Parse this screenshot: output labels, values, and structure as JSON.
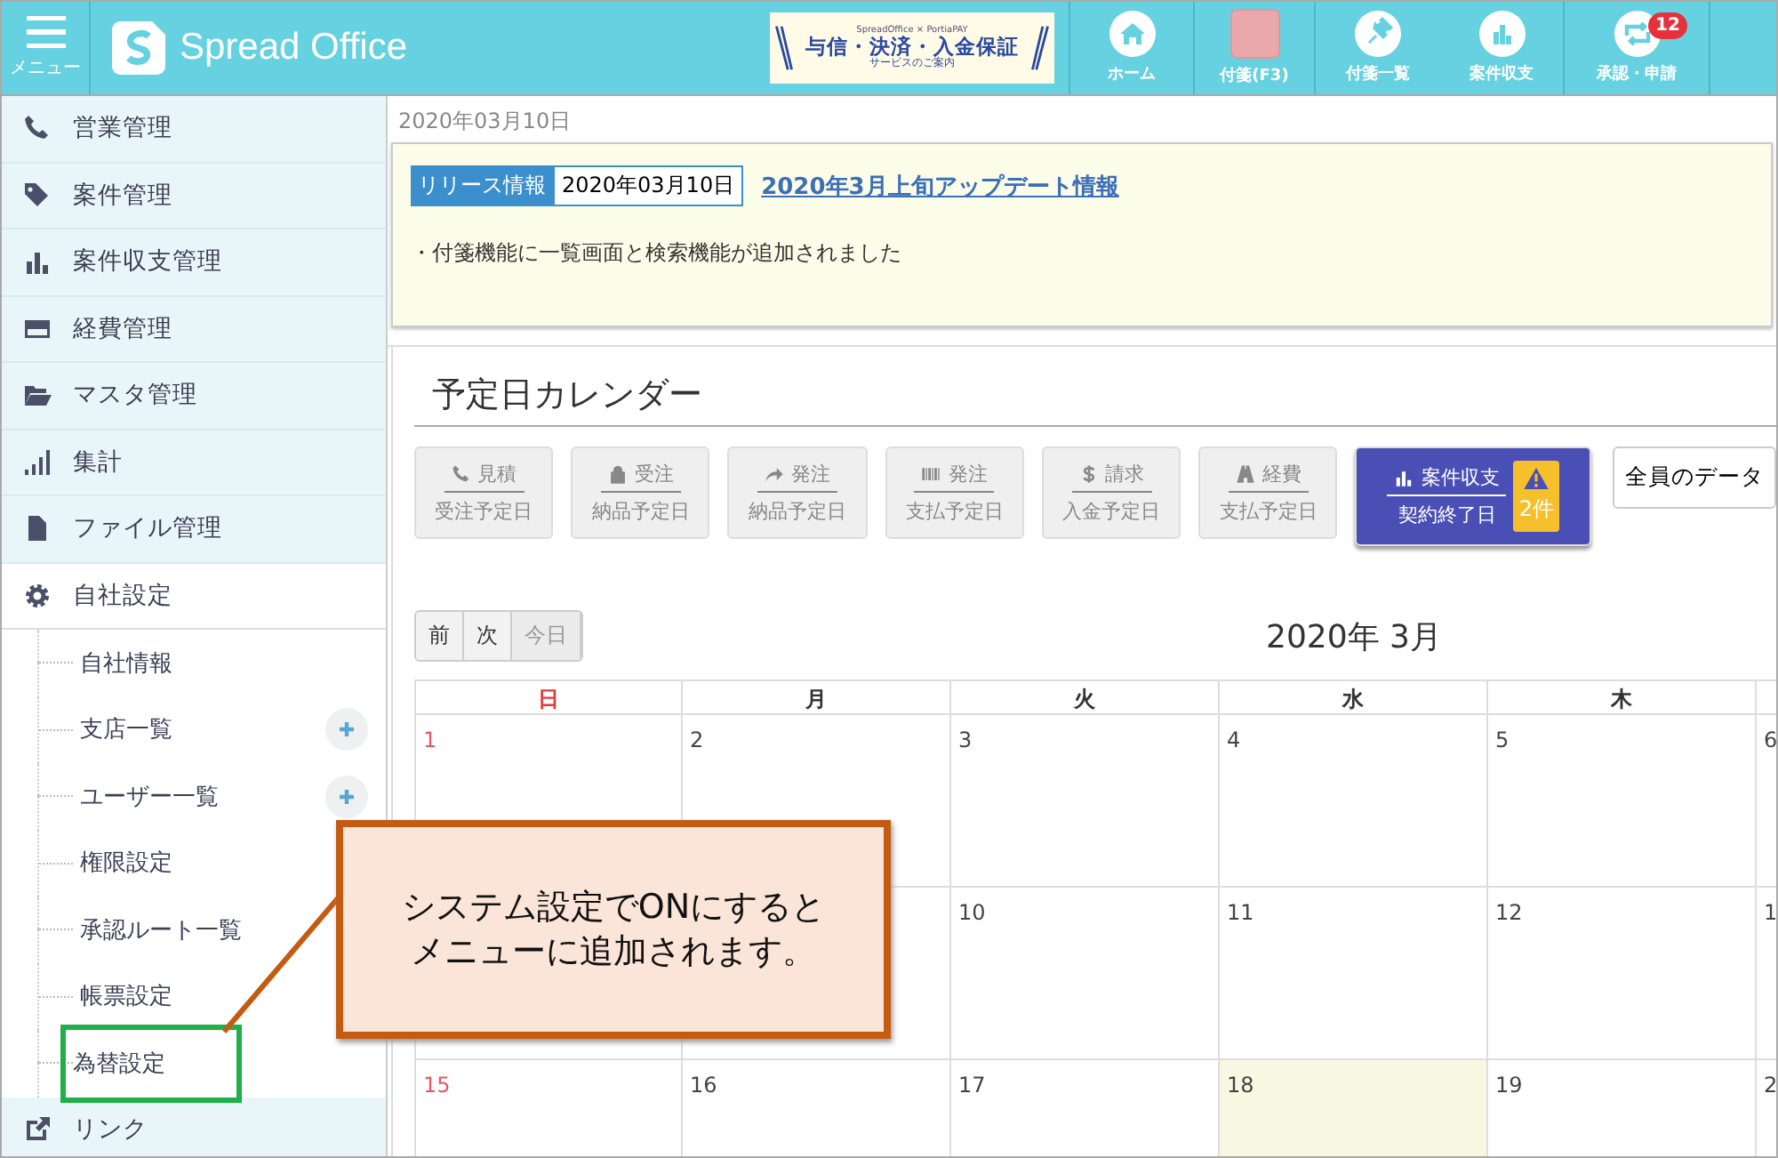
{
  "header": {
    "menu_label": "メニュー",
    "logo": "Spread Office",
    "banner": {
      "top": "SpreadOffice × PortiaPAY",
      "title": "与信・決済・入金保証",
      "subtitle": "サービスのご案内"
    },
    "nav": [
      {
        "kind": "home",
        "label": "ホーム"
      },
      {
        "kind": "note",
        "label": "付箋(F3)"
      },
      {
        "kind": "pin",
        "label": "付箋一覧"
      },
      {
        "kind": "chart",
        "label": "案件収支"
      },
      {
        "kind": "loop",
        "label": "承認・申請",
        "badge": "12"
      }
    ]
  },
  "sidebar": {
    "items": [
      {
        "kind": "phone",
        "label": "営業管理",
        "expanded": false
      },
      {
        "kind": "tag",
        "label": "案件管理",
        "expanded": false
      },
      {
        "kind": "bars",
        "label": "案件収支管理",
        "expanded": false
      },
      {
        "kind": "card",
        "label": "経費管理",
        "expanded": false
      },
      {
        "kind": "folder",
        "label": "マスタ管理",
        "expanded": false
      },
      {
        "kind": "signal",
        "label": "集計",
        "expanded": false
      },
      {
        "kind": "file",
        "label": "ファイル管理",
        "expanded": false
      },
      {
        "kind": "gear",
        "label": "自社設定",
        "expanded": true,
        "children": [
          {
            "label": "自社情報",
            "add": false,
            "highlighted": false
          },
          {
            "label": "支店一覧",
            "add": true,
            "highlighted": false
          },
          {
            "label": "ユーザー一覧",
            "add": true,
            "highlighted": false
          },
          {
            "label": "権限設定",
            "add": false,
            "highlighted": false
          },
          {
            "label": "承認ルート一覧",
            "add": false,
            "highlighted": false
          },
          {
            "label": "帳票設定",
            "add": false,
            "highlighted": false
          },
          {
            "label": "為替設定",
            "add": false,
            "highlighted": true
          }
        ]
      },
      {
        "kind": "link",
        "label": "リンク",
        "expanded": false
      }
    ]
  },
  "date": "2020年03月10日",
  "release": {
    "badge": "リリース情報",
    "date": "2020年03月10日",
    "link": "2020年3月上旬アップデート情報",
    "text": "・付箋機能に一覧画面と検索機能が追加されました"
  },
  "calendar": {
    "title": "予定日カレンダー",
    "filters": [
      {
        "kind": "phone",
        "top": "見積",
        "bottom": "受注予定日",
        "selected": false
      },
      {
        "kind": "lock",
        "top": "受注",
        "bottom": "納品予定日",
        "selected": false
      },
      {
        "kind": "arrow",
        "top": "発注",
        "bottom": "納品予定日",
        "selected": false
      },
      {
        "kind": "barcode",
        "top": "発注",
        "bottom": "支払予定日",
        "selected": false
      },
      {
        "kind": "dollar",
        "top": "請求",
        "bottom": "入金予定日",
        "selected": false
      },
      {
        "kind": "road",
        "top": "経費",
        "bottom": "支払予定日",
        "selected": false
      },
      {
        "kind": "bars",
        "top": "案件収支",
        "bottom": "契約終了日",
        "selected": true,
        "alert": "2件"
      }
    ],
    "scope": "全員のデータ",
    "nav": [
      {
        "label": "前",
        "disabled": false
      },
      {
        "label": "次",
        "disabled": false
      },
      {
        "label": "今日",
        "disabled": true
      }
    ],
    "month": "2020年 3月",
    "columns": [
      {
        "label": "日",
        "kind": "sunday"
      },
      {
        "label": "月",
        "kind": "weekday"
      },
      {
        "label": "火",
        "kind": "weekday"
      },
      {
        "label": "水",
        "kind": "weekday"
      },
      {
        "label": "木",
        "kind": "weekday"
      },
      {
        "kind": "weekday"
      }
    ],
    "weeks": [
      [
        {
          "day": "1",
          "today": false
        },
        {
          "day": "2",
          "today": false
        },
        {
          "day": "3",
          "today": false
        },
        {
          "day": "4",
          "today": false
        },
        {
          "day": "5",
          "today": false
        },
        {
          "day": "6",
          "today": false
        }
      ],
      [
        {
          "today": false
        },
        {
          "today": false
        },
        {
          "day": "10",
          "today": false
        },
        {
          "day": "11",
          "today": false
        },
        {
          "day": "12",
          "today": false
        },
        {
          "day": "1",
          "today": false
        }
      ],
      [
        {
          "day": "15",
          "today": false
        },
        {
          "day": "16",
          "today": false
        },
        {
          "day": "17",
          "today": false
        },
        {
          "day": "18",
          "today": true
        },
        {
          "day": "19",
          "today": false
        },
        {
          "day": "2",
          "today": false
        }
      ]
    ]
  },
  "callout": {
    "lines": [
      "システム設定でONにすると",
      "メニューに追加されます。"
    ]
  }
}
